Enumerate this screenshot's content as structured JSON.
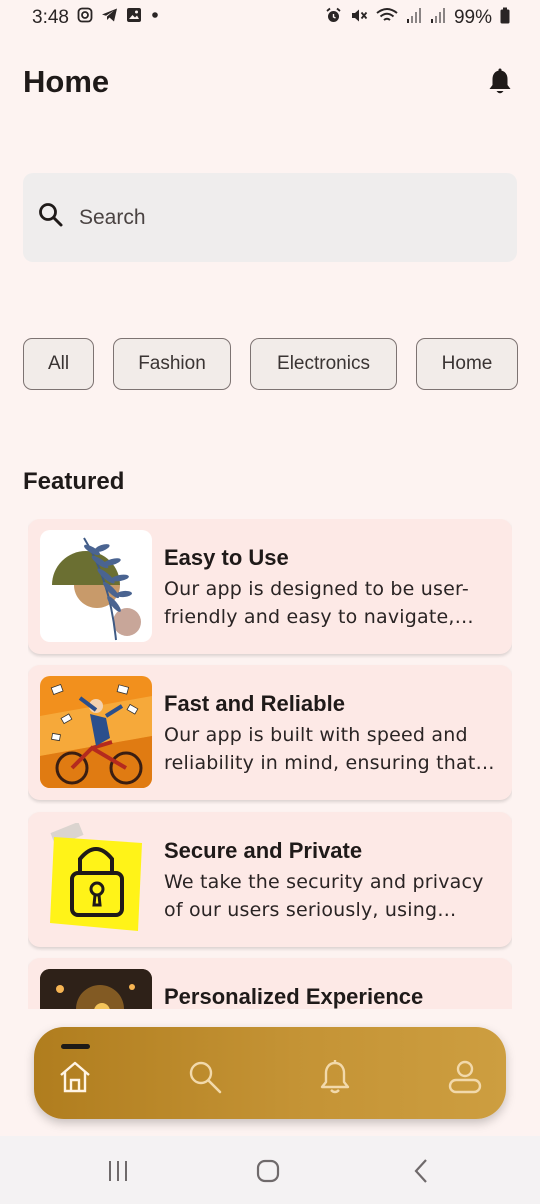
{
  "status_bar": {
    "time": "3:48",
    "battery": "99%",
    "left_icons": [
      "instagram-icon",
      "telegram-icon",
      "gallery-icon",
      "dot-icon"
    ],
    "right_icons": [
      "alarm-icon",
      "mute-icon",
      "wifi-icon",
      "signal-icon",
      "signal-icon",
      "battery-icon"
    ]
  },
  "header": {
    "title": "Home",
    "bell_icon": "bell-icon"
  },
  "search": {
    "placeholder": "Search",
    "icon": "search-icon"
  },
  "chips": [
    "All",
    "Fashion",
    "Electronics",
    "Home"
  ],
  "featured": {
    "title": "Featured",
    "items": [
      {
        "title": "Easy to Use",
        "description": "Our app is designed to be user-friendly and easy to navigate, making it simple for everyone."
      },
      {
        "title": "Fast and Reliable",
        "description": "Our app is built with speed and reliability in mind, ensuring that your experience is smooth."
      },
      {
        "title": "Secure and Private",
        "description": "We take the security and privacy of our users seriously, using industry-standard encryption."
      },
      {
        "title": "Personalized Experience",
        "description": ""
      }
    ]
  },
  "bottom_nav": {
    "items": [
      "home-icon",
      "search-icon",
      "notifications-icon",
      "profile-icon"
    ],
    "active": "home-icon"
  },
  "colors": {
    "background": "#fdf3f1",
    "card": "#fde9e6",
    "nav_gradient_start": "#b07d1e",
    "nav_gradient_end": "#cd9e40"
  }
}
